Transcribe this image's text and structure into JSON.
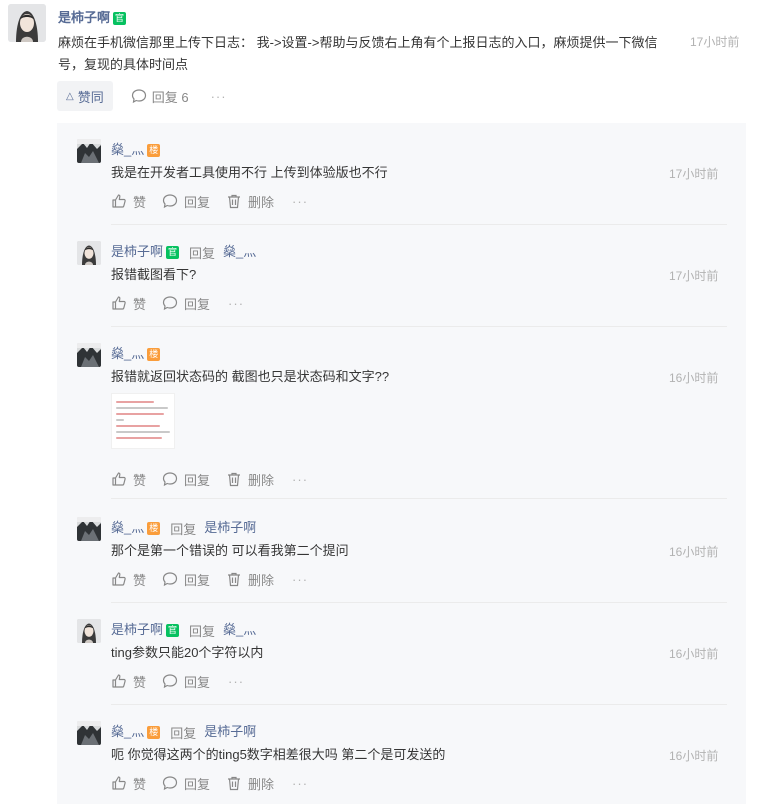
{
  "main_comment": {
    "author": "是柿子啊",
    "badge": "官",
    "text": "麻烦在手机微信那里上传下日志：  我->设置->帮助与反馈右上角有个上报日志的入口，麻烦提供一下微信号，复现的具体时间点",
    "time": "17小时前",
    "like_label": "赞同",
    "reply_label": "回复 6",
    "more": "···"
  },
  "replies": [
    {
      "author": "燊_灬",
      "badge": "楼",
      "badge_type": "floor",
      "reply_word": "",
      "reply_to": "",
      "time": "17小时前",
      "text": "我是在开发者工具使用不行 上传到体验版也不行",
      "actions": [
        "赞",
        "回复",
        "删除"
      ],
      "has_image": false
    },
    {
      "author": "是柿子啊",
      "badge": "官",
      "badge_type": "official",
      "reply_word": "回复",
      "reply_to": "燊_灬",
      "time": "17小时前",
      "text": "报错截图看下?",
      "actions": [
        "赞",
        "回复"
      ],
      "has_image": false
    },
    {
      "author": "燊_灬",
      "badge": "楼",
      "badge_type": "floor",
      "reply_word": "",
      "reply_to": "",
      "time": "16小时前",
      "text": "报错就返回状态码的 截图也只是状态码和文字??",
      "actions": [
        "赞",
        "回复",
        "删除"
      ],
      "has_image": true
    },
    {
      "author": "燊_灬",
      "badge": "楼",
      "badge_type": "floor",
      "reply_word": "回复",
      "reply_to": "是柿子啊",
      "time": "16小时前",
      "text": "那个是第一个错误的 可以看我第二个提问",
      "actions": [
        "赞",
        "回复",
        "删除"
      ],
      "has_image": false
    },
    {
      "author": "是柿子啊",
      "badge": "官",
      "badge_type": "official",
      "reply_word": "回复",
      "reply_to": "燊_灬",
      "time": "16小时前",
      "text": "ting参数只能20个字符以内",
      "actions": [
        "赞",
        "回复"
      ],
      "has_image": false
    },
    {
      "author": "燊_灬",
      "badge": "楼",
      "badge_type": "floor",
      "reply_word": "回复",
      "reply_to": "是柿子啊",
      "time": "16小时前",
      "text": "呃 你觉得这两个的ting5数字相差很大吗 第二个是可发送的",
      "actions": [
        "赞",
        "回复",
        "删除"
      ],
      "has_image": false
    }
  ],
  "colors": {
    "name": "#576b95",
    "official_badge": "#07c160",
    "floor_badge": "#fa9d3b",
    "reply_bg": "#f7f8fa",
    "muted": "#b2b2b2"
  }
}
